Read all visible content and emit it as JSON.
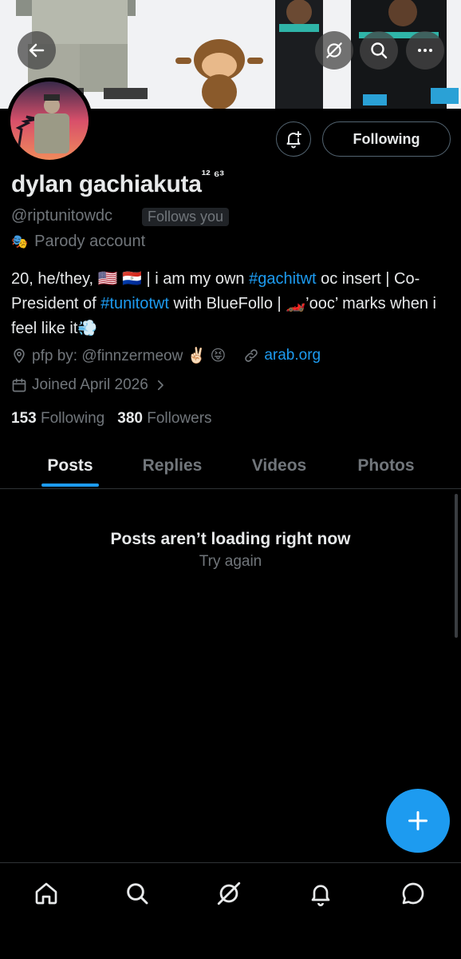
{
  "header": {
    "back_icon": "arrow-left-icon",
    "grok_icon": "grok-icon",
    "search_icon": "search-icon",
    "more_icon": "more-icon"
  },
  "profile": {
    "display_name": "dylan gachiakuta",
    "name_suffix": "¹² ⁶³",
    "handle": "@riptunitowdc",
    "follows_you": "Follows you",
    "parody_label": "Parody account",
    "parody_icon": "🎭",
    "follow_button": "Following",
    "bio": {
      "p1": "20, he/they, 🇺🇸 🇵🇾 | i am my own ",
      "tag1": "#gachitwt",
      "p2": " oc insert | Co-President of ",
      "tag2": "#tunitotwt",
      "p3": " with BlueFollo | 🏎️’ooc’ marks when i feel like it💨"
    },
    "location": "pfp by: @finnzermeow ✌🏻 😝",
    "website": "arab.org",
    "joined": "Joined April 2026",
    "following_count": "153",
    "following_label": "Following",
    "followers_count": "380",
    "followers_label": "Followers"
  },
  "tabs": [
    {
      "label": "Posts",
      "active": true
    },
    {
      "label": "Replies",
      "active": false
    },
    {
      "label": "Videos",
      "active": false
    },
    {
      "label": "Photos",
      "active": false
    }
  ],
  "feed": {
    "error_title": "Posts aren’t loading right now",
    "retry_label": "Try again"
  },
  "colors": {
    "accent": "#1d9bf0",
    "background": "#000000",
    "muted_text": "#71767b",
    "border": "#2f3336"
  },
  "bottom_nav": [
    "home-icon",
    "search-icon",
    "grok-icon",
    "notifications-icon",
    "messages-icon"
  ]
}
